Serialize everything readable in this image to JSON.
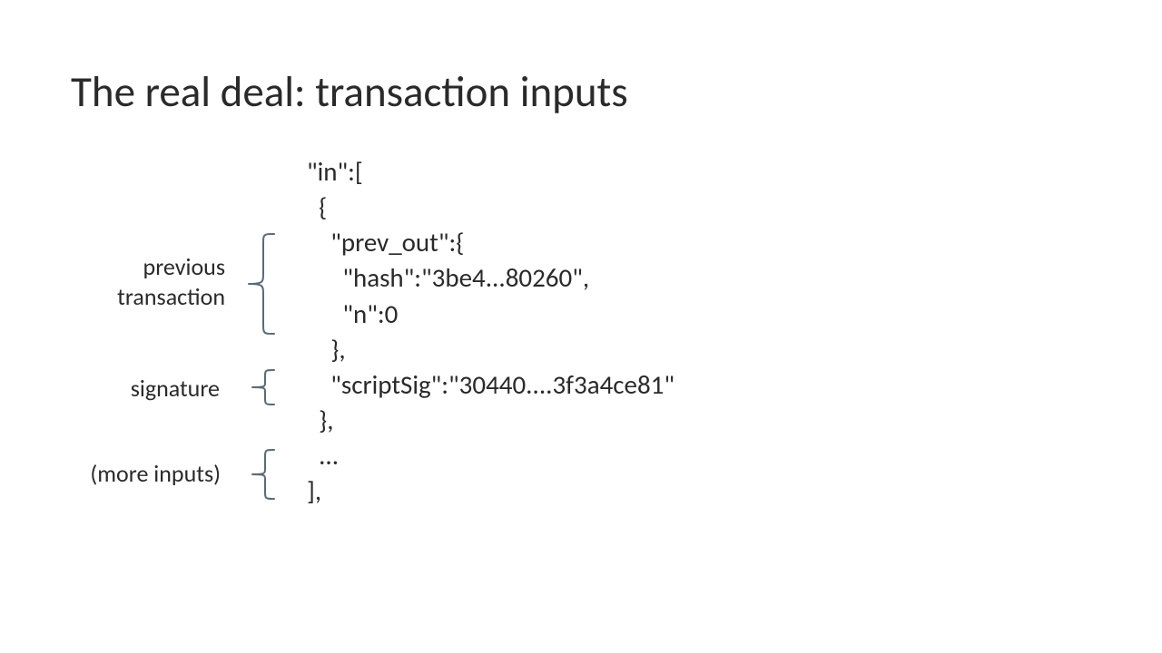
{
  "title": "The real deal: transaction inputs",
  "labels": {
    "previous_line1": "previous",
    "previous_line2": "transaction",
    "signature": "signature",
    "more_inputs": "(more inputs)"
  },
  "code": {
    "line1": "\"in\":[",
    "line2": "  {",
    "line3": "    \"prev_out\":{",
    "line4": "      \"hash\":\"3be4...80260\",",
    "line5": "      \"n\":0",
    "line6": "    },",
    "line7": "    \"scriptSig\":\"30440....3f3a4ce81\"",
    "line8": "  },",
    "line9": "  ...",
    "line10": "],"
  }
}
